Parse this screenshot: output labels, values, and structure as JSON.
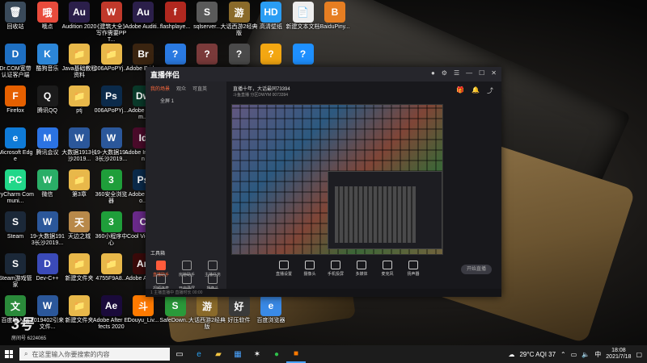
{
  "desktop": {
    "icons": [
      {
        "label": "回收站",
        "glyph": "🗑",
        "color": "#3a4a5a"
      },
      {
        "label": "哦点",
        "glyph": "哦",
        "color": "#e94b3c"
      },
      {
        "label": "Audition 2020",
        "glyph": "Au",
        "color": "#2b1f4a"
      },
      {
        "label": "《建筑大全》写作需要PPT...",
        "glyph": "W",
        "color": "#c0392b"
      },
      {
        "label": "Adobe Auditi...",
        "glyph": "Au",
        "color": "#2b1f4a"
      },
      {
        "label": "flashplaye...",
        "glyph": "f",
        "color": "#b0281f"
      },
      {
        "label": "sqlserver...",
        "glyph": "S",
        "color": "#5a5a5a"
      },
      {
        "label": "大话西游2经典版",
        "glyph": "游",
        "color": "#8a6a2a"
      },
      {
        "label": "高清壁纸",
        "glyph": "HD",
        "color": "#2a9df4"
      },
      {
        "label": "新建文本文档",
        "glyph": "📄",
        "color": "#eeeeee"
      },
      {
        "label": "BaiduPiny...",
        "glyph": "B",
        "color": "#e67e22"
      },
      {
        "label": "Dr.COM宽带认证客户端",
        "glyph": "D",
        "color": "#1e6fc2"
      },
      {
        "label": "酷狗音乐",
        "glyph": "K",
        "color": "#2c86d8"
      },
      {
        "label": "Java基础教程资料",
        "glyph": "📁",
        "color": "#e8b84a"
      },
      {
        "label": "006APoPYj...",
        "glyph": "📁",
        "color": "#e8b84a"
      },
      {
        "label": "Adobe Bridge",
        "glyph": "Br",
        "color": "#3a2410"
      },
      {
        "label": "",
        "glyph": "?",
        "color": "#2a7ae2"
      },
      {
        "label": "",
        "glyph": "?",
        "color": "#7a3a3a"
      },
      {
        "label": "",
        "glyph": "?",
        "color": "#4a4a4a"
      },
      {
        "label": "",
        "glyph": "?",
        "color": "#f3a712"
      },
      {
        "label": "",
        "glyph": "?",
        "color": "#1e90ff"
      },
      {
        "label": "应用回归分析-第2章课后...",
        "glyph": "W",
        "color": "#2b579a"
      },
      {
        "label": "Firefox",
        "glyph": "F",
        "color": "#e66000"
      },
      {
        "label": "腾讯QQ",
        "glyph": "Q",
        "color": "#1b1b1b"
      },
      {
        "label": "ptj",
        "glyph": "📁",
        "color": "#e8b84a"
      },
      {
        "label": "006APoPYj...",
        "glyph": "Ps",
        "color": "#0b2a4a"
      },
      {
        "label": "Adobe Dream...",
        "glyph": "Dw",
        "color": "#0a3a2a"
      },
      {
        "label": "Microsoft Edge",
        "glyph": "e",
        "color": "#0f7bd8"
      },
      {
        "label": "腾讯会议",
        "glyph": "M",
        "color": "#2b73e3"
      },
      {
        "label": "大数据1913长沙2019...",
        "glyph": "W",
        "color": "#2b579a"
      },
      {
        "label": "19-大数据1913长沙2019...",
        "glyph": "W",
        "color": "#2b579a"
      },
      {
        "label": "Adobe InDesign",
        "glyph": "Id",
        "color": "#4a0b2a"
      },
      {
        "label": "PyCharm Communi...",
        "glyph": "PC",
        "color": "#21d789"
      },
      {
        "label": "微信",
        "glyph": "W",
        "color": "#2aae67"
      },
      {
        "label": "第3章",
        "glyph": "📁",
        "color": "#e8b84a"
      },
      {
        "label": "360安全浏览器",
        "glyph": "3",
        "color": "#1f9e3a"
      },
      {
        "label": "Adobe Photo...",
        "glyph": "Ps",
        "color": "#0b2a4a"
      },
      {
        "label": "Steam",
        "glyph": "S",
        "color": "#1b2838"
      },
      {
        "label": "19-大数据1913长沙2019...",
        "glyph": "W",
        "color": "#2b579a"
      },
      {
        "label": "天边之城",
        "glyph": "天",
        "color": "#b8894a"
      },
      {
        "label": "360小程序中心",
        "glyph": "3",
        "color": "#1f9e3a"
      },
      {
        "label": "Cool Video...",
        "glyph": "C",
        "color": "#6a2a8a"
      },
      {
        "label": "Steam游戏管家",
        "glyph": "S",
        "color": "#1b2838"
      },
      {
        "label": "Dev-C++",
        "glyph": "D",
        "color": "#3a4ab8"
      },
      {
        "label": "新建文件夹",
        "glyph": "📁",
        "color": "#e8b84a"
      },
      {
        "label": "4755F9A8...",
        "glyph": "📁",
        "color": "#e8b84a"
      },
      {
        "label": "Adobe Anim...",
        "glyph": "An",
        "color": "#3a0a0a"
      },
      {
        "label": "百度输入法",
        "glyph": "文",
        "color": "#2a8a3a"
      },
      {
        "label": "2019402引来文件...",
        "glyph": "W",
        "color": "#2b579a"
      },
      {
        "label": "新建文件夹",
        "glyph": "📁",
        "color": "#e8b84a"
      },
      {
        "label": "Adobe After Effects 2020",
        "glyph": "Ae",
        "color": "#1a0a3a"
      },
      {
        "label": "Douyu_Liv...",
        "glyph": "斗",
        "color": "#ff7a00"
      },
      {
        "label": "SafeDown...",
        "glyph": "S",
        "color": "#2a9a3a"
      },
      {
        "label": "大话西游2经典版",
        "glyph": "游",
        "color": "#8a6a2a"
      },
      {
        "label": "好压软件",
        "glyph": "好",
        "color": "#3a3a3a"
      },
      {
        "label": "百度浏览器",
        "glyph": "e",
        "color": "#3a8ae6"
      }
    ]
  },
  "app": {
    "logo": "直播伴侣",
    "tabs": [
      "我的场景",
      "观众",
      "可直英"
    ],
    "scene_item": "全屏 1",
    "tools_title": "工具箱",
    "tools": [
      "直播助手",
      "房管助手",
      "主播任务",
      "视频连麦",
      "开启录屏",
      "摄像头",
      "超级连麦",
      "语音模式",
      "歌词助手"
    ],
    "room_title": "直播十年，大话最同73394",
    "room_badge": "更多",
    "room_sub": "斗鱼直播  分区DWYM  0073394",
    "controls": [
      "直播设置",
      "摄像头",
      "手机投屏",
      "多媒体",
      "麦克风",
      "扬声器"
    ],
    "start_label": "开始直播",
    "status": "1 主播直播中  直播时长 00:00"
  },
  "watermark": {
    "big": "3号",
    "small": "房间号 6224065"
  },
  "taskbar": {
    "search_placeholder": "在这里输入你要搜索的内容",
    "weather": "29°C  AQI 37",
    "time": "18:08",
    "date": "2021/7/18"
  }
}
